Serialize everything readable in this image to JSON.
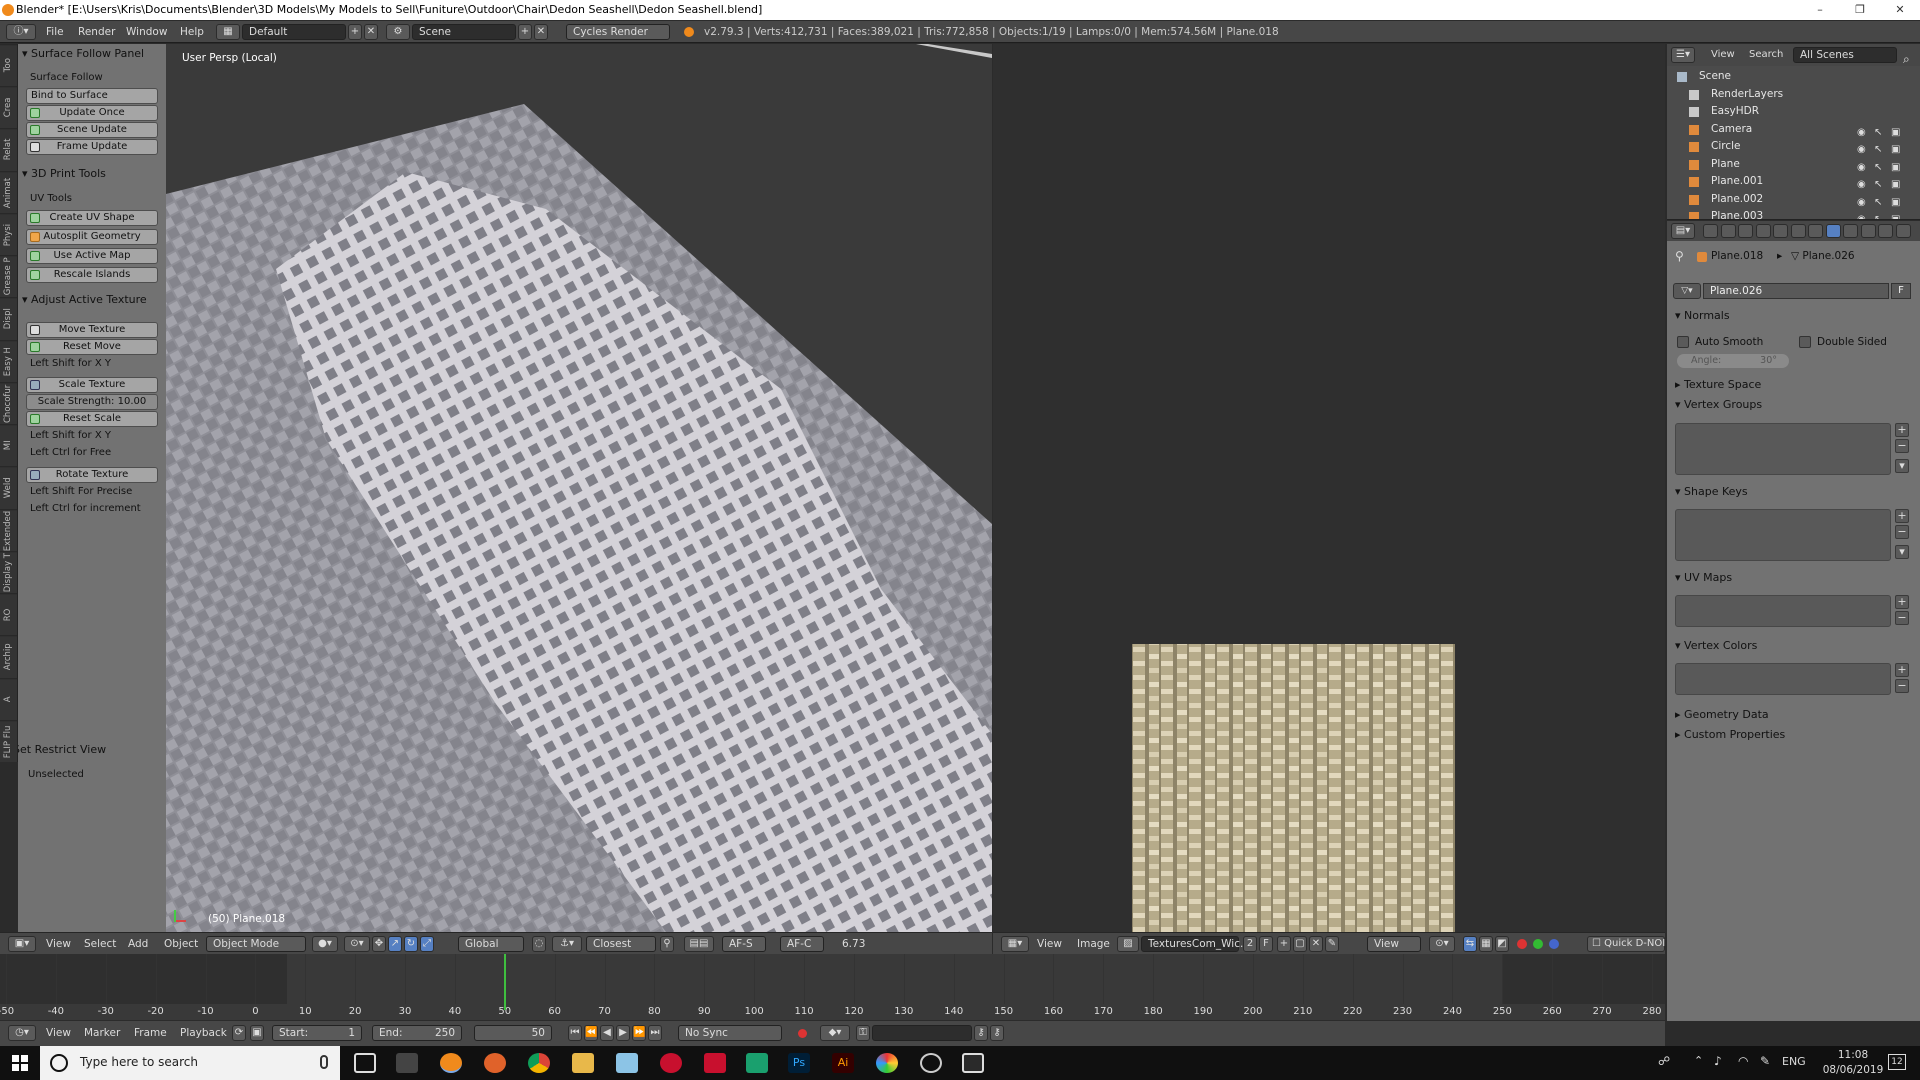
{
  "titlebar": {
    "title": "Blender* [E:\\Users\\Kris\\Documents\\Blender\\3D Models\\My Models to Sell\\Funiture\\Outdoor\\Chair\\Dedon Seashell\\Dedon Seashell.blend]",
    "min": "–",
    "max": "❐",
    "close": "✕"
  },
  "infobar": {
    "menus": [
      "File",
      "Render",
      "Window",
      "Help"
    ],
    "layout": "Default",
    "scene": "Scene",
    "engine": "Cycles Render",
    "stats": "v2.79.3 | Verts:412,731 | Faces:389,021 | Tris:772,858 | Objects:1/19 | Lamps:0/0 | Mem:574.56M | Plane.018"
  },
  "left_tabs": [
    "Too",
    "Crea",
    "Relat",
    "Animat",
    "Physi",
    "Grease P",
    "Displ",
    "Easy H",
    "Chocofur Model M",
    "MI",
    "Weld",
    "Extended",
    "Display T",
    "RO",
    "Archip",
    "A",
    "FLIP Flu"
  ],
  "tools": {
    "surface_follow": {
      "header": "Surface Follow Panel",
      "label": "Surface Follow",
      "bind": "Bind to Surface",
      "update_once": "Update Once",
      "scene_update": "Scene Update",
      "frame_update": "Frame Update"
    },
    "print3d": {
      "header": "3D Print Tools",
      "label": "UV Tools",
      "create_uv": "Create UV Shape",
      "autosplit": "Autosplit Geometry",
      "use_active": "Use Active Map",
      "rescale": "Rescale Islands"
    },
    "adjust": {
      "header": "Adjust Active Texture",
      "move": "Move Texture",
      "reset_move": "Reset Move",
      "hint1": "Left Shift for X Y",
      "scale": "Scale Texture",
      "strength_label": "Scale Strength:",
      "strength_value": "10.00",
      "reset_scale": "Reset Scale",
      "hint2": "Left Shift for X Y",
      "hint3": "Left Ctrl for Free",
      "rotate": "Rotate Texture",
      "hint4": "Left Shift For Precise",
      "hint5": "Left Ctrl for increment"
    },
    "restrict": {
      "header": "Set Restrict View",
      "unselected": "Unselected"
    }
  },
  "viewport": {
    "label": "User Persp (Local)",
    "object": "(50) Plane.018"
  },
  "view3d_header": {
    "menus": [
      "View",
      "Select",
      "Add",
      "Object"
    ],
    "mode": "Object Mode",
    "orientation": "Global",
    "snap": "Closest",
    "afs": "AF-S",
    "afc": "AF-C",
    "value": "6.73"
  },
  "image_header": {
    "menus": [
      "View",
      "Image"
    ],
    "image": "TexturesCom_Wic...",
    "users": "2",
    "fake": "F",
    "view": "View",
    "quick": "Quick D-NOI"
  },
  "timeline": {
    "ticks": [
      -50,
      -40,
      -30,
      -20,
      -10,
      0,
      10,
      20,
      30,
      40,
      50,
      60,
      70,
      80,
      90,
      100,
      110,
      120,
      130,
      140,
      150,
      160,
      170,
      180,
      190,
      200,
      210,
      220,
      230,
      240,
      250,
      260,
      270,
      280
    ],
    "current_frame": 50,
    "start": 0,
    "end": 250,
    "menus": [
      "View",
      "Marker",
      "Frame",
      "Playback"
    ],
    "start_label": "Start:",
    "start_val": "1",
    "end_label": "End:",
    "end_val": "250",
    "frame_val": "50",
    "sync": "No Sync"
  },
  "outliner": {
    "menus": [
      "View",
      "Search"
    ],
    "scenes": "All Scenes",
    "rows": [
      {
        "name": "Scene",
        "icon_color": "#a9b9c9"
      },
      {
        "name": "RenderLayers",
        "icon_color": "#c9c9c9"
      },
      {
        "name": "EasyHDR",
        "icon_color": "#c9c9c9"
      },
      {
        "name": "Camera",
        "icon_color": "#e08a3c"
      },
      {
        "name": "Circle",
        "icon_color": "#e08a3c"
      },
      {
        "name": "Plane",
        "icon_color": "#e08a3c"
      },
      {
        "name": "Plane.001",
        "icon_color": "#e08a3c"
      },
      {
        "name": "Plane.002",
        "icon_color": "#e08a3c"
      },
      {
        "name": "Plane.003",
        "icon_color": "#e08a3c"
      }
    ]
  },
  "properties": {
    "breadcrumb_obj": "Plane.018",
    "breadcrumb_mesh": "Plane.026",
    "datablock": "Plane.026",
    "fake": "F",
    "normals": "Normals",
    "auto_smooth": "Auto Smooth",
    "double_sided": "Double Sided",
    "angle_label": "Angle:",
    "angle_value": "30°",
    "texture_space": "Texture Space",
    "vertex_groups": "Vertex Groups",
    "shape_keys": "Shape Keys",
    "uv_maps": "UV Maps",
    "vertex_colors": "Vertex Colors",
    "geometry_data": "Geometry Data",
    "custom_props": "Custom Properties"
  },
  "taskbar": {
    "search_placeholder": "Type here to search",
    "lang": "ENG",
    "time": "11:08",
    "date": "08/06/2019",
    "notif": "12"
  },
  "colors": {
    "accent": "#5680c2",
    "frame_line": "#3fbf3f",
    "orange": "#f08a1c"
  }
}
